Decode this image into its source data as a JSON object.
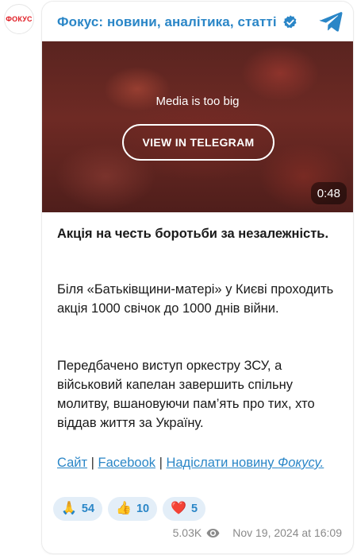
{
  "channel": {
    "logo_text": "ФОКУС",
    "title": "Фокус: новини, аналітика, статті",
    "verified_icon": "verified-badge-icon",
    "app_icon": "telegram-icon"
  },
  "media": {
    "message": "Media is too big",
    "button_label": "VIEW IN TELEGRAM",
    "duration": "0:48"
  },
  "post": {
    "headline": "Акція на честь боротьби за незалежність.",
    "paragraph1": "Біля «Батьківщини-матері» у Києві проходить акція 1000 свічок до 1000 днів війни.",
    "paragraph2": "Передбачено виступ оркестру ЗСУ, а військовий капелан завершить спільну молитву, вшановуючи пам’ять про тих, хто віддав життя за Україну.",
    "links": {
      "site": "Сайт",
      "sep1": " | ",
      "facebook": "Facebook",
      "sep2": " | ",
      "send_news": "Надіслати новину ",
      "send_news_italic": "Фокусу."
    }
  },
  "reactions": [
    {
      "emoji": "🙏",
      "count": "54"
    },
    {
      "emoji": "👍",
      "count": "10"
    },
    {
      "emoji": "❤️",
      "count": "5"
    }
  ],
  "footer": {
    "views": "5.03K",
    "date": "Nov 19, 2024 at 16:09"
  },
  "colors": {
    "accent": "#2a86c7",
    "logo_red": "#e01b22",
    "reaction_bg": "#e3eef8"
  }
}
